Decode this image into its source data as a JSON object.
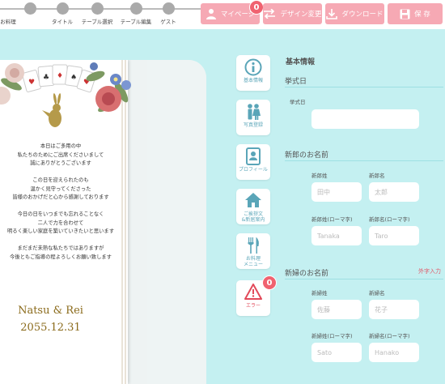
{
  "steps": [
    "お料理",
    "タイトル",
    "テーブル選択",
    "テーブル編集",
    "ゲスト"
  ],
  "toolbar": {
    "mypage": "マイページ",
    "mypage_badge": "0",
    "design": "デザイン変更",
    "download": "ダウンロード",
    "save": "保 存"
  },
  "card": {
    "message": "本日はご多用の中\n私たちのためにご出席くださいまして\n誠にありがとうございます\n\nこの日を迎えられたのも\n温かく見守ってくださった\n皆様のおかげだと心から感謝しております\n\n今日の日をいつまでも忘れることなく\n二人で力を合わせて\n明るく楽しい家庭を築いていきたいと思います\n\nまだまだ未熟な私たちではありますが\n今後ともご指導の程よろしくお願い致します",
    "names": "Natsu & Rei",
    "date": "2055.12.31"
  },
  "tabs": [
    {
      "label": "基本情報",
      "icon": "info-icon"
    },
    {
      "label": "写真登録",
      "icon": "couple-icon"
    },
    {
      "label": "プロフィール",
      "icon": "profile-icon"
    },
    {
      "label": "ご挨拶文\n&新居案内",
      "icon": "house-icon"
    },
    {
      "label": "お料理\nメニュー",
      "icon": "cutlery-icon"
    },
    {
      "label": "エラー",
      "icon": "warning-icon",
      "badge": "0"
    }
  ],
  "form": {
    "title": "基本情報",
    "ceremony": {
      "heading": "挙式日",
      "label": "挙式日",
      "value": ""
    },
    "groom": {
      "heading": "新郎のお名前",
      "last_label": "新郎姓",
      "last_ph": "田中",
      "first_label": "新郎名",
      "first_ph": "太郎",
      "last_roma_label": "新郎姓(ローマ字)",
      "last_roma_ph": "Tanaka",
      "first_roma_label": "新郎名(ローマ字)",
      "first_roma_ph": "Taro"
    },
    "bride": {
      "heading": "新婦のお名前",
      "gaiji": "外字入力",
      "last_label": "新婦姓",
      "last_ph": "佐藤",
      "first_label": "新婦名",
      "first_ph": "花子",
      "last_roma_label": "新婦姓(ローマ字)",
      "last_roma_ph": "Sato",
      "first_roma_label": "新婦名(ローマ字)",
      "first_roma_ph": "Hanako"
    }
  },
  "colors": {
    "accent": "#f6a9b4",
    "bg": "#c4f0f1",
    "tab_text": "#5aa5b8",
    "error": "#f06270"
  }
}
